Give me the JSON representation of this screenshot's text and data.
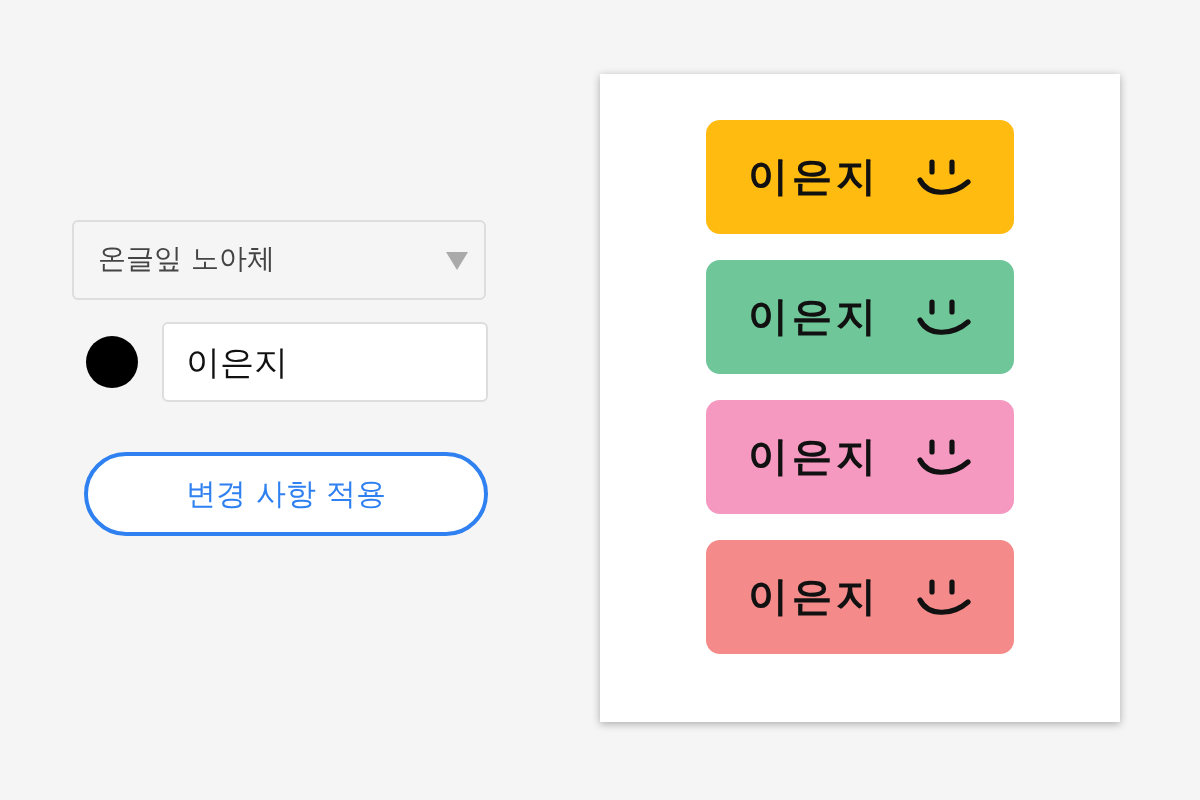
{
  "font_select": {
    "value": "온글잎 노아체"
  },
  "color_dot": {
    "color": "#000000"
  },
  "name_field": {
    "value": "이은지"
  },
  "apply_button": {
    "label": "변경 사항 적용"
  },
  "labels": [
    {
      "text": "이은지",
      "color": "#ffbb0f"
    },
    {
      "text": "이은지",
      "color": "#6fc698"
    },
    {
      "text": "이은지",
      "color": "#f599c1"
    },
    {
      "text": "이은지",
      "color": "#f58a8a"
    }
  ]
}
